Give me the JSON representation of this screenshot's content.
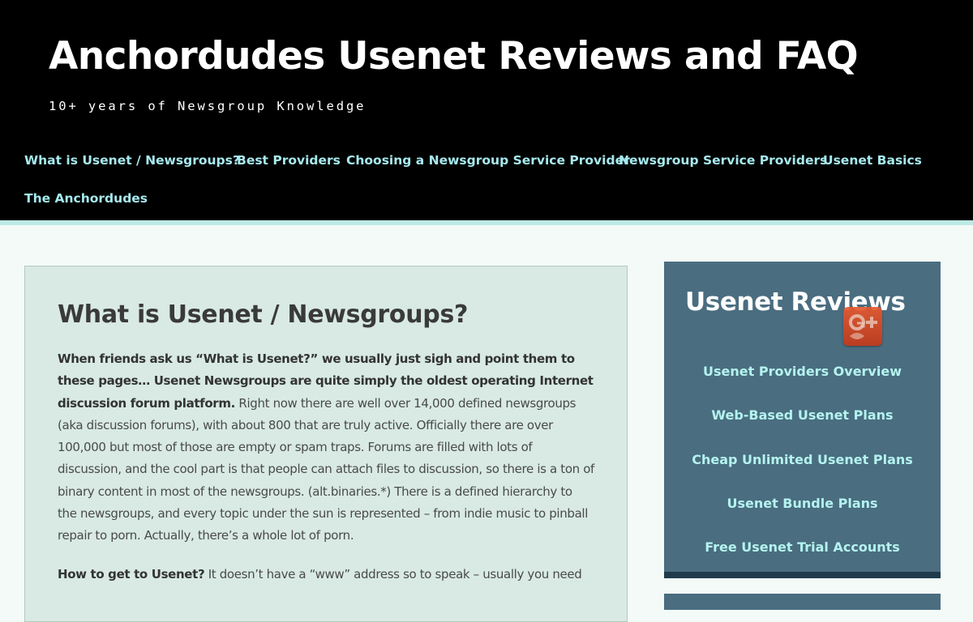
{
  "header": {
    "title": "Anchordudes Usenet Reviews and FAQ",
    "tagline": "10+ years of Newsgroup Knowledge",
    "nav": [
      {
        "label": "What is Usenet / Newsgroups?"
      },
      {
        "label": "Best Providers"
      },
      {
        "label": "Choosing a Newsgroup Service Provider"
      },
      {
        "label": "Newsgroup Service Providers"
      },
      {
        "label": "Usenet Basics"
      },
      {
        "label": "The Anchordudes"
      }
    ]
  },
  "article": {
    "title": "What is Usenet / Newsgroups?",
    "p1_bold": "When friends ask us “What is Usenet?” we usually just sigh and point them to these pages… Usenet Newsgroups are quite simply the oldest operating Internet discussion forum platform.",
    "p1_text": "  Right now there are well over 14,000 defined newsgroups (aka discussion forums), with about 800 that are truly active.  Officially there are over 100,000 but most of those are empty or spam traps. Forums are filled with lots of discussion, and the cool part is that people can attach files to discussion, so there is a ton of binary content in most of the newsgroups. (alt.binaries.*) There is a defined hierarchy to the newsgroups, and every topic under the sun is represented – from indie music to pinball repair to porn.  Actually, there’s a whole lot of porn.",
    "p2_bold": "How to get to Usenet?",
    "p2_text": "  It doesn’t have a “www” address so to speak – usually you need"
  },
  "sidebar": {
    "widget_title": "Usenet Reviews",
    "badge_icon": "google-plus-icon",
    "links": [
      {
        "label": "Usenet Providers Overview"
      },
      {
        "label": "Web-Based Usenet Plans"
      },
      {
        "label": "Cheap Unlimited Usenet Plans"
      },
      {
        "label": "Usenet Bundle Plans"
      },
      {
        "label": "Free Usenet Trial Accounts"
      }
    ]
  },
  "colors": {
    "header_bg": "#000000",
    "nav_link": "#a6e9ee",
    "page_bg": "#f3faf7",
    "article_bg": "#d8eae3",
    "sidebar_bg": "#4a6d80",
    "sidebar_link": "#b4f3ef",
    "badge": "#d8462a"
  }
}
